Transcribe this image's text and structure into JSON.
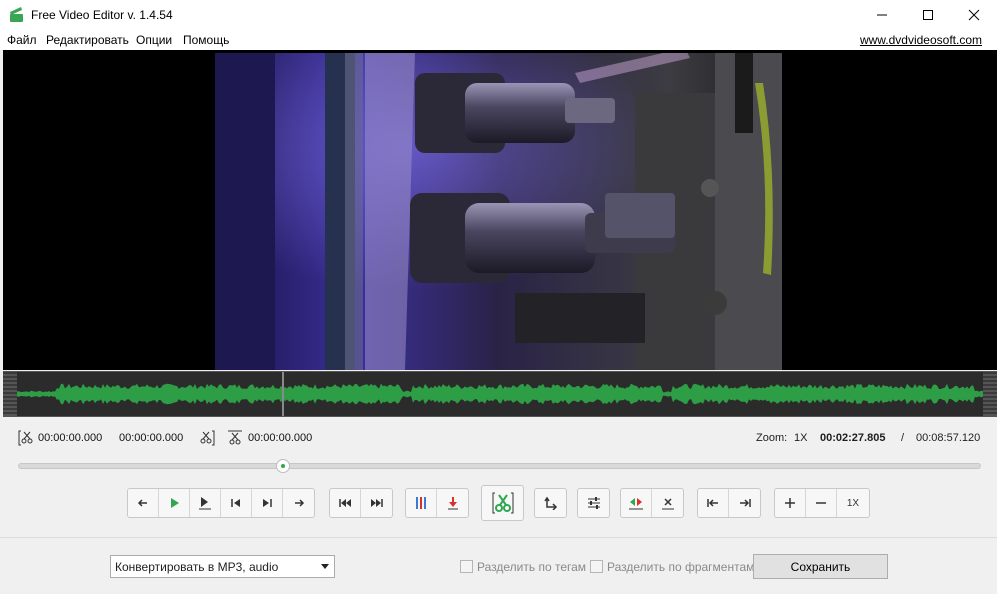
{
  "window": {
    "title": "Free Video Editor v. 1.4.54",
    "controls": [
      "minimize-icon",
      "maximize-icon",
      "close-icon"
    ]
  },
  "menu": {
    "items": [
      "Файл",
      "Редактировать",
      "Опции",
      "Помощь"
    ],
    "site_link": "www.dvdvideosoft.com"
  },
  "times": {
    "selection_start": "00:00:00.000",
    "selection_end": "00:00:00.000",
    "cut_position": "00:00:00.000",
    "zoom_label": "Zoom:",
    "zoom_value": "1X",
    "current_time": "00:02:27.805",
    "separator": "/",
    "total_time": "00:08:57.120"
  },
  "playback": {
    "position_fraction": 0.275
  },
  "toolbar": {
    "zoom_value": "1X"
  },
  "bottom": {
    "format_select": "Конвертировать в MP3, audio",
    "split_by_tags": "Разделить по тегам",
    "split_by_fragments": "Разделить по фрагментам",
    "save_label": "Сохранить"
  },
  "colors": {
    "accent_green": "#2fa84f",
    "waveform_green": "#2e9e46",
    "marker_red": "#d9302c",
    "marker_blue": "#3a7bd5"
  }
}
